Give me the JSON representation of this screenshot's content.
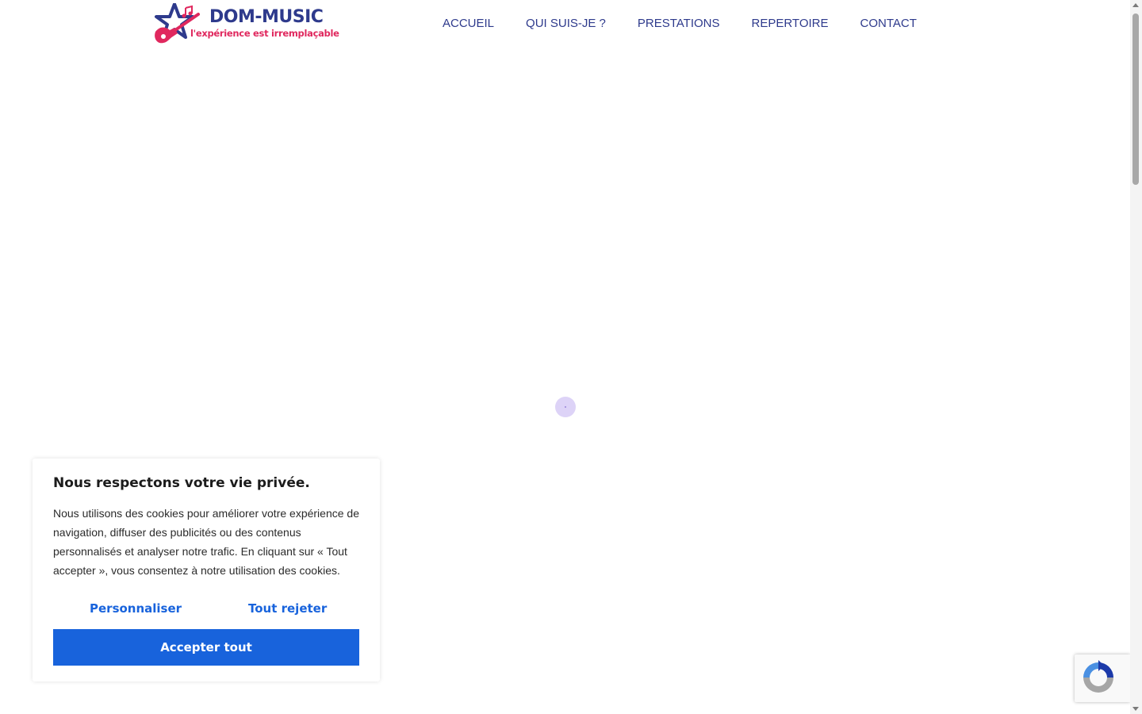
{
  "brand": {
    "name": "DOM-MUSIC",
    "tagline": "l'expérience est irremplaçable",
    "colors": {
      "primary": "#2e3a8c",
      "accent": "#e0285e"
    }
  },
  "nav": {
    "items": [
      {
        "label": "ACCUEIL"
      },
      {
        "label": "QUI SUIS-JE ?"
      },
      {
        "label": "PRESTATIONS"
      },
      {
        "label": "REPERTOIRE"
      },
      {
        "label": "CONTACT"
      }
    ]
  },
  "cookie_banner": {
    "title": "Nous respectons votre vie privée.",
    "text": "Nous utilisons des cookies pour améliorer votre expérience de navigation, diffuser des publicités ou des contenus personnalisés et analyser notre trafic. En cliquant sur « Tout accepter », vous consentez à notre utilisation des cookies.",
    "customize_label": "Personnaliser",
    "reject_label": "Tout rejeter",
    "accept_label": "Accepter tout",
    "button_color": "#1863dc"
  },
  "icons": {
    "logo": "star-guitar-logo-icon",
    "loader": "loading-spinner-icon",
    "recaptcha": "recaptcha-icon"
  }
}
